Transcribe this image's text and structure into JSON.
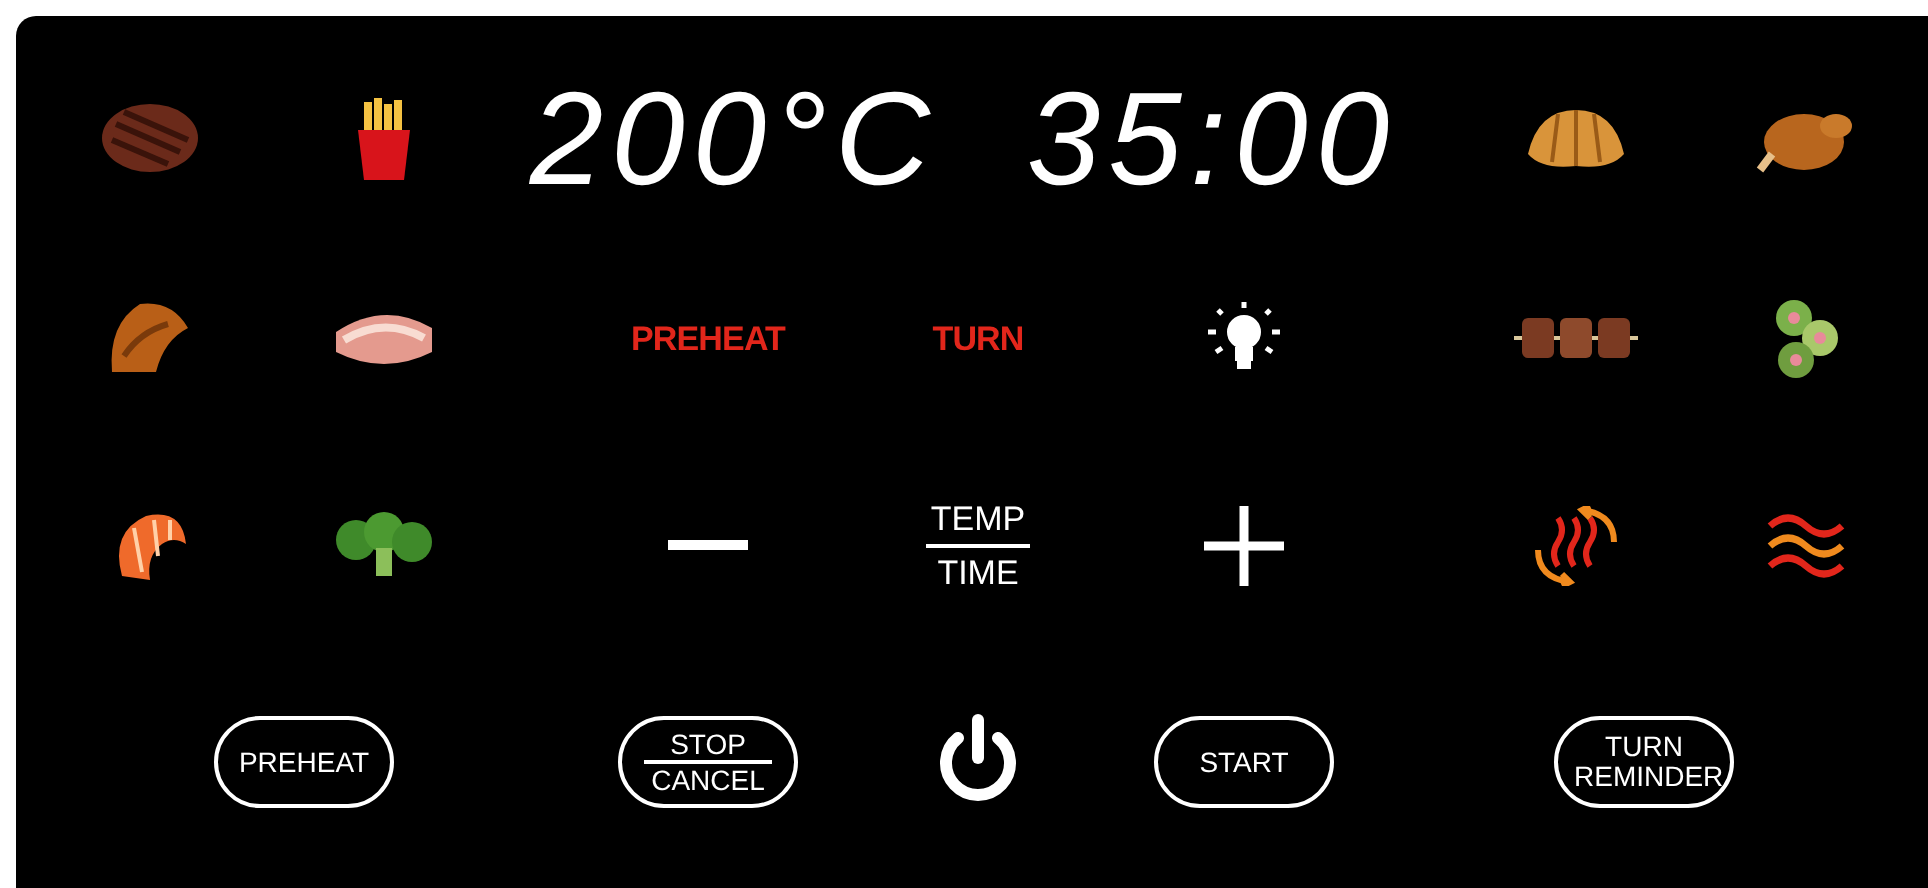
{
  "display": {
    "temperature": "200°C",
    "time": "35:00"
  },
  "indicators": [
    {
      "label": "PREHEAT",
      "on": true
    },
    {
      "label": "TURN",
      "on": true
    }
  ],
  "adjust": {
    "upper": "TEMP",
    "lower": "TIME"
  },
  "buttons": [
    {
      "kind": "text",
      "label": "PREHEAT"
    },
    {
      "kind": "split",
      "upper": "STOP",
      "lower": "CANCEL"
    },
    {
      "kind": "power"
    },
    {
      "kind": "text",
      "label": "START"
    },
    {
      "kind": "text",
      "label": "TURN REMINDER"
    }
  ]
}
